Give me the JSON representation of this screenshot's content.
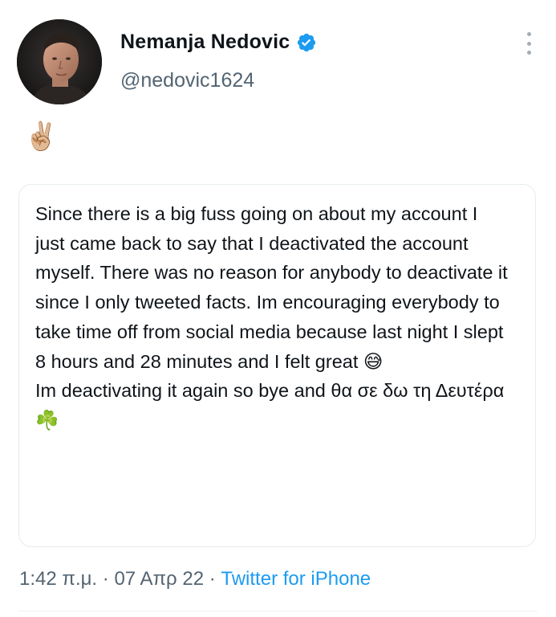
{
  "author": {
    "display_name": "Nemanja Nedovic",
    "handle": "@nedovic1624",
    "verified_icon": "verified-badge-icon",
    "avatar_icon": "avatar-photo"
  },
  "tweet": {
    "text": "✌🏼"
  },
  "quote": {
    "text": "Since there is a big fuss going on about my account I just came back to say that I deactivated the account myself. There was no reason for anybody to deactivate it since I only tweeted facts. Im encouraging everybody to take time off from social media because last night I slept 8 hours and 28 minutes and I felt great 😅\nIm deactivating it again so bye and θα σε δω τη Δευτέρα ☘️"
  },
  "meta": {
    "time": "1:42 π.μ.",
    "separator": " · ",
    "date": "07 Απρ 22",
    "source": "Twitter for iPhone"
  },
  "colors": {
    "verified": "#1d9bf0",
    "link": "#1d9bf0",
    "secondary_text": "#536471"
  }
}
